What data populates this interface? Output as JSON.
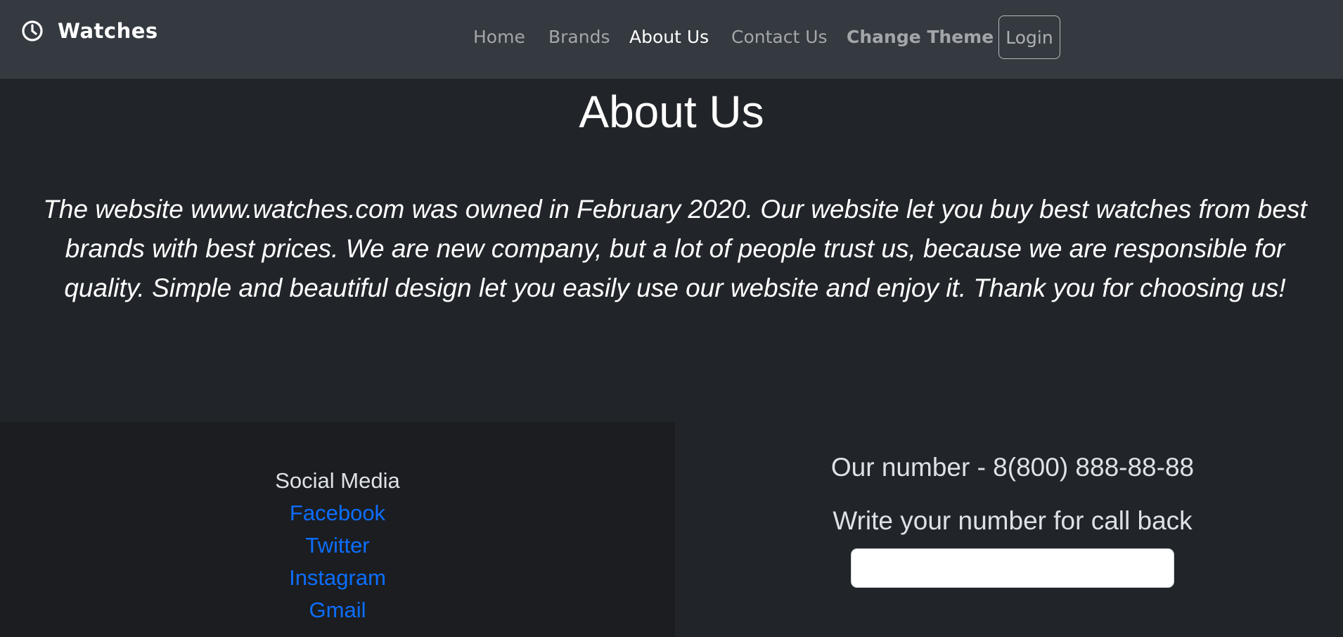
{
  "navbar": {
    "brand": "Watches",
    "brand_icon": "clock-icon",
    "links": {
      "home": "Home",
      "brands": "Brands",
      "about": "About Us",
      "contact": "Contact Us",
      "theme": "Change Theme"
    },
    "active_link": "About Us",
    "login": "Login"
  },
  "main": {
    "title": "About Us",
    "text": "The website www.watches.com was owned in February 2020. Our website let you buy best watches from best brands with best prices. We are new company, but a lot of people trust us, because we are responsible for quality. Simple and beautiful design let you easily use our website and enjoy it. Thank you for choosing us!"
  },
  "footer": {
    "social_title": "Social Media",
    "social_links": [
      "Facebook",
      "Twitter",
      "Instagram",
      "Gmail"
    ],
    "phone": "Our number - 8(800) 888-88-88",
    "callback_label": "Write your number for call back",
    "callback_value": ""
  },
  "colors": {
    "page_bg": "#212529",
    "navbar_bg": "#343a40",
    "footer_left_bg": "#1b1d21",
    "link": "#0d6efd"
  }
}
